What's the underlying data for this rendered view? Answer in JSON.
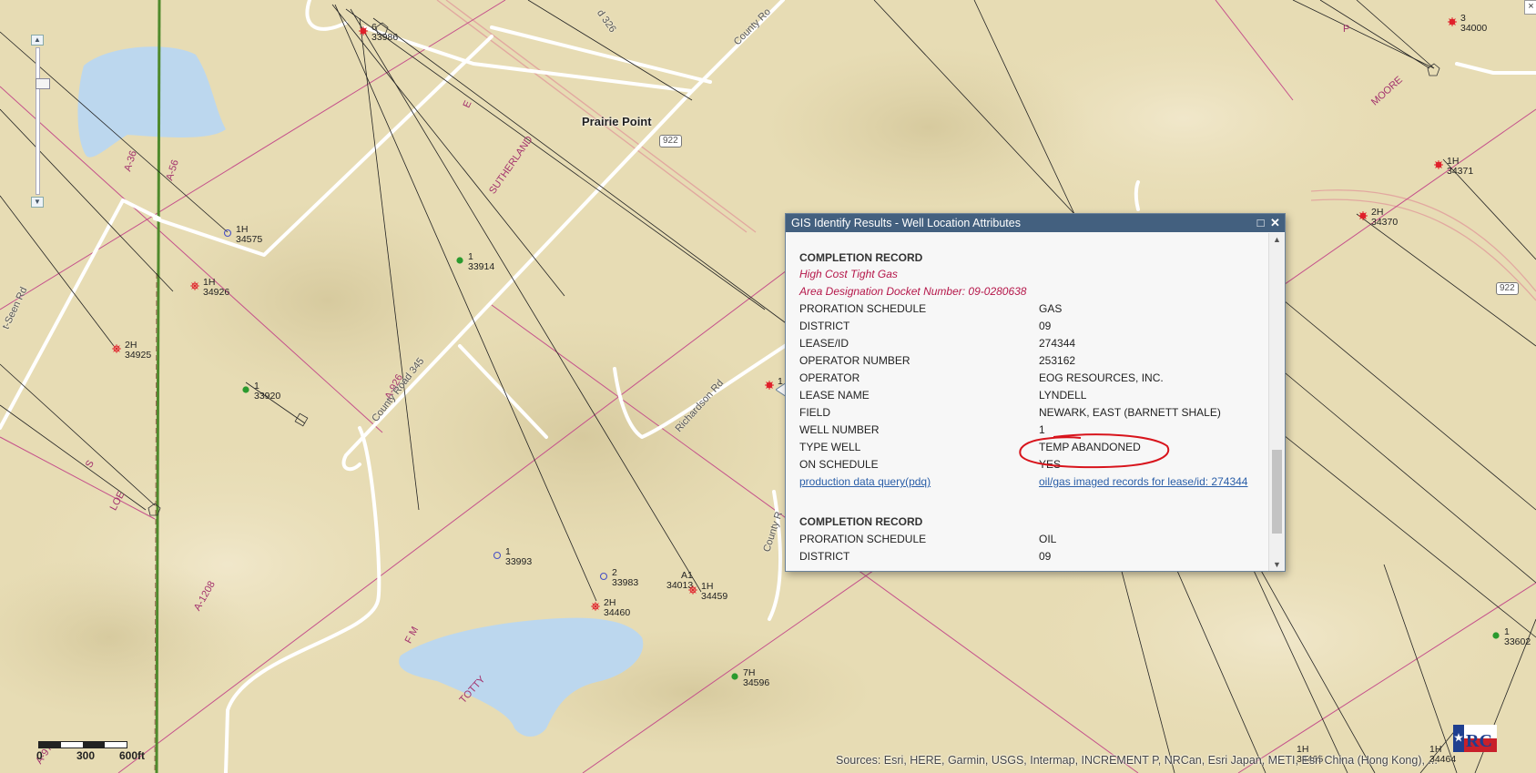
{
  "map": {
    "place_label": "Prairie Point",
    "zoom_slider": {
      "level_fraction": 0.22
    },
    "road_labels": [
      {
        "id": "county-road-345",
        "text": "County Road 345"
      },
      {
        "id": "richardson-rd",
        "text": "Richardson Rd"
      },
      {
        "id": "county-rd-top",
        "text": "County Ro"
      },
      {
        "id": "rd-326",
        "text": "d 326"
      },
      {
        "id": "county-r-mid",
        "text": "County R"
      },
      {
        "id": "seen-rd",
        "text": "t-Seen Rd"
      }
    ],
    "highway_shields": [
      "922",
      "922"
    ],
    "survey_labels": [
      "A-36",
      "A-56",
      "E",
      "SUTHERLAND",
      "A-926",
      "S",
      "LOE",
      "A-1208",
      "F M",
      "TOTTY",
      "P",
      "MOORE",
      "A-97"
    ],
    "wells": [
      {
        "num": "6",
        "api": "33986",
        "status": "permitted"
      },
      {
        "num": "3",
        "api": "34000",
        "status": "permitted"
      },
      {
        "num": "1H",
        "api": "34575",
        "status": "dry"
      },
      {
        "num": "1",
        "api": "33914",
        "status": "oil"
      },
      {
        "num": "1H",
        "api": "34926",
        "status": "gas-abandoned"
      },
      {
        "num": "2H",
        "api": "34925",
        "status": "gas-abandoned"
      },
      {
        "num": "1",
        "api": "33920",
        "status": "oil"
      },
      {
        "num": "1",
        "api": "33993",
        "status": "dry"
      },
      {
        "num": "2",
        "api": "33983",
        "status": "dry"
      },
      {
        "num": "A1",
        "api": "34013",
        "status": "dry"
      },
      {
        "num": "1H",
        "api": "34459",
        "status": "gas-abandoned"
      },
      {
        "num": "2H",
        "api": "34460",
        "status": "gas-abandoned"
      },
      {
        "num": "7H",
        "api": "34596",
        "status": "oil"
      },
      {
        "num": "1H",
        "api": "34371",
        "status": "permitted"
      },
      {
        "num": "2H",
        "api": "34370",
        "status": "permitted"
      },
      {
        "num": "1",
        "api": "33602",
        "status": "oil"
      },
      {
        "num": "1H",
        "api": "34465",
        "status": "gas"
      },
      {
        "num": "1H",
        "api": "34464",
        "status": "gas"
      },
      {
        "num": "1",
        "api": "",
        "status": "permitted"
      }
    ],
    "scalebar": {
      "labels": [
        "0",
        "300",
        "600ft"
      ]
    },
    "attribution": "Sources: Esri, HERE, Garmin, USGS, Intermap, INCREMENT P, NRCan, Esri Japan, METI, Esri China (Hong Kong), ...",
    "colors": {
      "terrain": "#e7dcb4",
      "water": "#bcd7ee",
      "road": "#ffffff",
      "survey_line": "#c5508b",
      "county_line": "#4f8a2c"
    }
  },
  "popup": {
    "title": "GIS Identify Results - Well Location Attributes",
    "records": [
      {
        "heading": "COMPLETION RECORD",
        "notes": [
          "High Cost Tight Gas",
          "Area Designation Docket Number: 09-0280638"
        ],
        "rows": [
          {
            "label": "PRORATION SCHEDULE",
            "value": "GAS"
          },
          {
            "label": "DISTRICT",
            "value": "09"
          },
          {
            "label": "LEASE/ID",
            "value": "274344"
          },
          {
            "label": "OPERATOR NUMBER",
            "value": "253162"
          },
          {
            "label": "OPERATOR",
            "value": "EOG RESOURCES, INC."
          },
          {
            "label": "LEASE NAME",
            "value": "LYNDELL"
          },
          {
            "label": "FIELD",
            "value": "NEWARK, EAST (BARNETT SHALE)"
          },
          {
            "label": "WELL NUMBER",
            "value": "1"
          },
          {
            "label": "TYPE WELL",
            "value": "TEMP ABANDONED"
          },
          {
            "label": "ON SCHEDULE",
            "value": "YES"
          }
        ],
        "links": [
          "production data query(pdq)",
          "oil/gas imaged records for lease/id: 274344"
        ]
      },
      {
        "heading": "COMPLETION RECORD",
        "rows": [
          {
            "label": "PRORATION SCHEDULE",
            "value": "OIL"
          },
          {
            "label": "DISTRICT",
            "value": "09"
          }
        ]
      }
    ],
    "colors": {
      "titlebar": "#43607f",
      "note": "#b5174a",
      "link": "#2a5ea8",
      "annotation": "#d8141c"
    }
  }
}
